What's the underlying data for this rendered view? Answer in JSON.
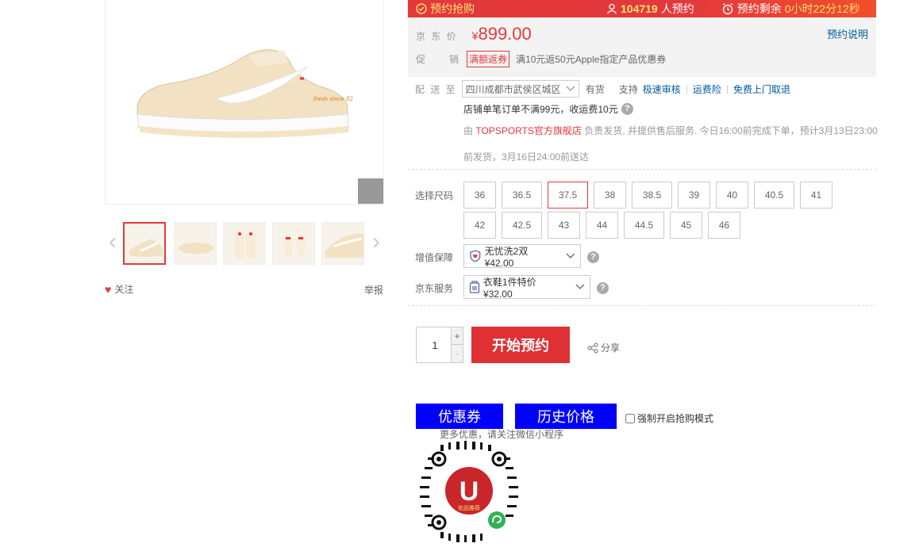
{
  "banner": {
    "presale_label": "预约抢购",
    "count": "104719",
    "count_suffix": "人预约",
    "remaining_label": "预约剩余",
    "remaining_time": "0小时22分12秒"
  },
  "price": {
    "label": "京 东 价",
    "currency": "¥",
    "value": "899.00",
    "presale_note": "预约说明"
  },
  "promo": {
    "label": "促　　销",
    "tag": "满额返券",
    "text": "满10元返50元Apple指定产品优惠券"
  },
  "delivery": {
    "label": "配 送 至",
    "address": "四川成都市武侯区城区",
    "stock": "有货",
    "support": "支持",
    "links": [
      "极速审核",
      "运费险",
      "免费上门取退"
    ],
    "freight_note": "店铺单笔订单不满99元，收运费10元",
    "seller_prefix": "由",
    "shop_name": "TOPSPORTS官方旗舰店",
    "seller_text": "负责发货, 并提供售后服务. 今日16:00前完成下单，预计3月13日23:00",
    "seller_text2": "前发货，3月16日24:00前送达"
  },
  "sizes": {
    "label": "选择尺码",
    "options": [
      "36",
      "36.5",
      "37.5",
      "38",
      "38.5",
      "39",
      "40",
      "40.5",
      "41",
      "42",
      "42.5",
      "43",
      "44",
      "44.5",
      "45",
      "46"
    ],
    "selected": "37.5"
  },
  "services": {
    "warranty_label": "增值保障",
    "warranty_value": "无忧洗2双 ¥42.00",
    "jd_label": "京东服务",
    "jd_value": "衣鞋1件特价 ¥32.00"
  },
  "purchase": {
    "quantity": "1",
    "plus": "+",
    "minus": "-",
    "buy_label": "开始预约",
    "share_label": "分享"
  },
  "extra": {
    "coupon_label": "优惠券",
    "history_label": "历史价格",
    "force_mode_label": "强制开启抢购模式",
    "wechat_tip": "更多优惠，请关注微信小程序",
    "qr_brand": "U",
    "qr_caption": "优品推荐"
  },
  "gallery": {
    "follow_label": "关注",
    "report_label": "举报"
  },
  "colors": {
    "jd_red": "#e4393c",
    "link_blue": "#005aa0",
    "coupon_blue": "#0000ff"
  }
}
